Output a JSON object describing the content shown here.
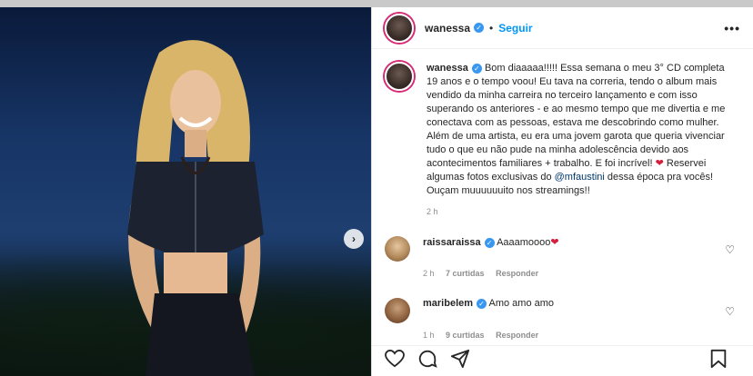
{
  "post": {
    "author": "wanessa",
    "follow_label": "Seguir",
    "more_label": "•••",
    "caption": "Bom diaaaaa!!!!! Essa semana o meu 3° CD completa 19 anos e o tempo voou! Eu tava na correria, tendo o album mais vendido da minha carreira no terceiro lançamento e com isso superando os anteriores - e ao mesmo tempo que me divertia e me conectava com as pessoas, estava me descobrindo como mulher. Além de uma artista, eu era uma jovem garota que queria vivenciar tudo o que eu não pude na minha adolescência devido aos acontecimentos familiares + trabalho. E foi incrível!",
    "caption_tail_a": "Reservei algumas fotos exclusivas do",
    "caption_mention": "@mfaustini",
    "caption_tail_b": "dessa época pra vocês! Ouçam muuuuuuito nos streamings!!",
    "time": "2 h"
  },
  "comments": [
    {
      "user": "raissaraissa",
      "text": "Aaaamoooo",
      "time": "2 h",
      "likes": "7 curtidas",
      "reply": "Responder"
    },
    {
      "user": "maribelem",
      "text": "Amo amo amo",
      "time": "1 h",
      "likes": "9 curtidas",
      "reply": "Responder"
    }
  ],
  "icons": [
    "heart-icon",
    "comment-icon",
    "share-icon",
    "save-icon",
    "next-arrow-icon"
  ]
}
